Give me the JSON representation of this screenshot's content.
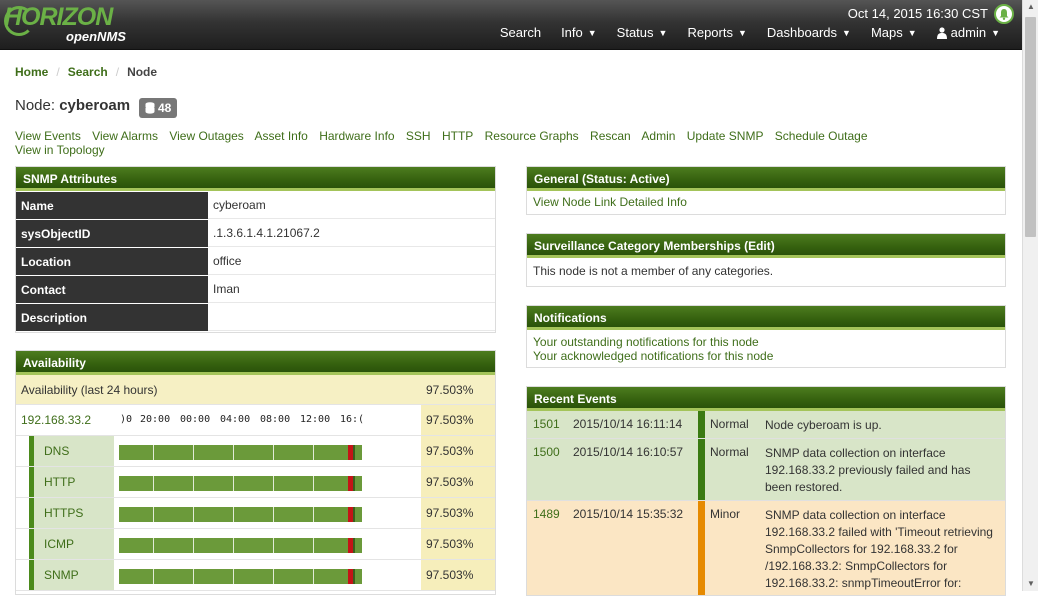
{
  "header": {
    "logo_main": "HORIZON",
    "logo_sub": "openNMS",
    "datetime": "Oct 14, 2015 16:30 CST",
    "nav": [
      {
        "label": "Search",
        "caret": false
      },
      {
        "label": "Info",
        "caret": true
      },
      {
        "label": "Status",
        "caret": true
      },
      {
        "label": "Reports",
        "caret": true
      },
      {
        "label": "Dashboards",
        "caret": true
      },
      {
        "label": "Maps",
        "caret": true
      },
      {
        "label": "admin",
        "caret": true,
        "icon": "user-icon"
      }
    ]
  },
  "breadcrumb": {
    "home": "Home",
    "search": "Search",
    "current": "Node"
  },
  "node": {
    "prefix": "Node:",
    "name": "cyberoam",
    "badge": "48",
    "badge_icon": "database-icon"
  },
  "actions": [
    "View Events",
    "View Alarms",
    "View Outages",
    "Asset Info",
    "Hardware Info",
    "SSH",
    "HTTP",
    "Resource Graphs",
    "Rescan",
    "Admin",
    "Update SNMP",
    "Schedule Outage",
    "View in Topology"
  ],
  "snmp": {
    "title": "SNMP Attributes",
    "rows": [
      {
        "key": "Name",
        "value": "cyberoam"
      },
      {
        "key": "sysObjectID",
        "value": ".1.3.6.1.4.1.21067.2"
      },
      {
        "key": "Location",
        "value": "office"
      },
      {
        "key": "Contact",
        "value": "Iman"
      },
      {
        "key": "Description",
        "value": ""
      }
    ]
  },
  "availability": {
    "title": "Availability",
    "overall_label": "Availability (last 24 hours)",
    "overall_pct": "97.503%",
    "interface": "192.168.33.2",
    "interface_pct": "97.503%",
    "ticks": [
      ")0",
      "20:00",
      "00:00",
      "04:00",
      "08:00",
      "12:00",
      "16:("
    ],
    "services": [
      {
        "name": "DNS",
        "pct": "97.503%"
      },
      {
        "name": "HTTP",
        "pct": "97.503%"
      },
      {
        "name": "HTTPS",
        "pct": "97.503%"
      },
      {
        "name": "ICMP",
        "pct": "97.503%"
      },
      {
        "name": "SNMP",
        "pct": "97.503%"
      }
    ]
  },
  "general": {
    "title": "General (Status: Active)",
    "link": "View Node Link Detailed Info"
  },
  "surveillance": {
    "title": "Surveillance Category Memberships (Edit)",
    "text": "This node is not a member of any categories."
  },
  "notifications": {
    "title": "Notifications",
    "links": [
      "Your outstanding notifications for this node",
      "Your acknowledged notifications for this node"
    ]
  },
  "events": {
    "title": "Recent Events",
    "rows": [
      {
        "id": "1501",
        "time": "2015/10/14 16:11:14",
        "severity": "Normal",
        "message": "Node cyberoam is up."
      },
      {
        "id": "1500",
        "time": "2015/10/14 16:10:57",
        "severity": "Normal",
        "message": "SNMP data collection on interface 192.168.33.2 previously failed and has been restored."
      },
      {
        "id": "1489",
        "time": "2015/10/14 15:35:32",
        "severity": "Minor",
        "message": "SNMP data collection on interface 192.168.33.2 failed with 'Timeout retrieving SnmpCollectors for 192.168.33.2 for /192.168.33.2: SnmpCollectors for 192.168.33.2: snmpTimeoutError for:"
      }
    ]
  }
}
